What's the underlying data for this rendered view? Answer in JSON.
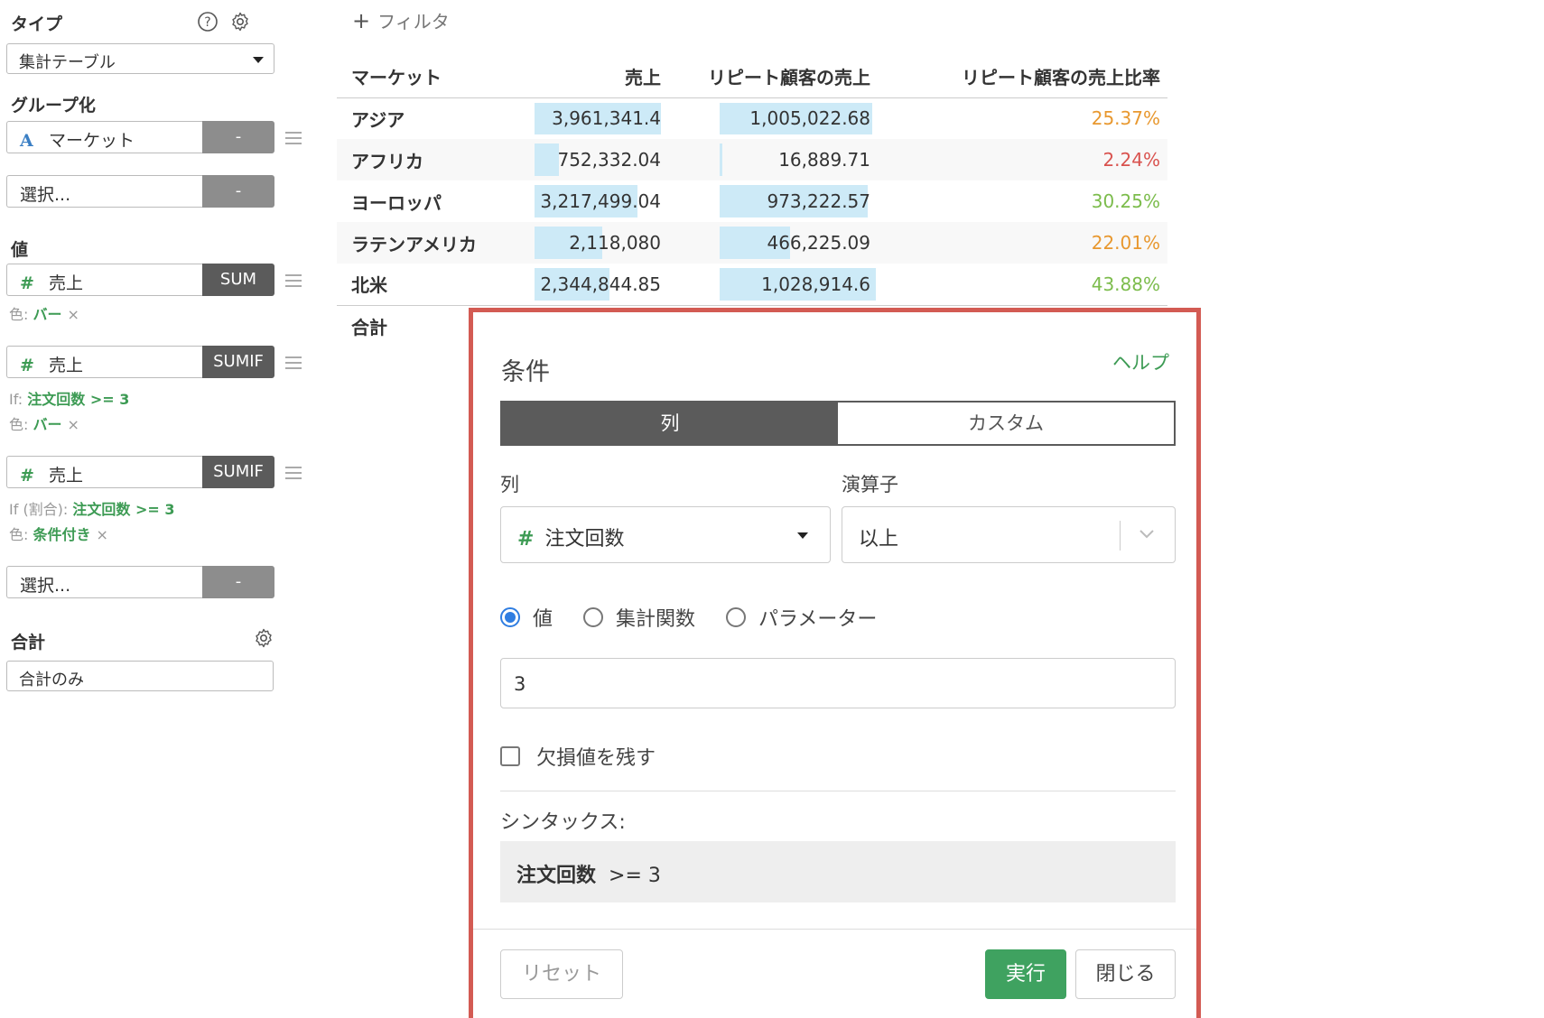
{
  "left_panel": {
    "type": {
      "title": "タイプ",
      "selected": "集計テーブル"
    },
    "group": {
      "title": "グループ化",
      "field": {
        "type_icon": "A",
        "name": "マーケット",
        "agg": "-"
      },
      "empty": {
        "placeholder": "選択...",
        "agg": "-"
      }
    },
    "values": {
      "title": "値",
      "items": [
        {
          "type_icon": "#",
          "name": "売上",
          "agg": "SUM",
          "color_label": "色:",
          "color_value": "バー",
          "remove": "×"
        },
        {
          "type_icon": "#",
          "name": "売上",
          "agg": "SUMIF",
          "if_label": "If:",
          "if_value": "注文回数 >= 3",
          "color_label": "色:",
          "color_value": "バー",
          "remove": "×"
        },
        {
          "type_icon": "#",
          "name": "売上",
          "agg": "SUMIF",
          "if_label": "If (割合):",
          "if_value": "注文回数 >= 3",
          "color_label": "色:",
          "color_value": "条件付き",
          "remove": "×"
        }
      ],
      "empty": {
        "placeholder": "選択...",
        "agg": "-"
      }
    },
    "total": {
      "title": "合計",
      "selected": "合計のみ"
    }
  },
  "filter": {
    "plus": "+",
    "label": "フィルタ"
  },
  "table": {
    "headers": [
      "マーケット",
      "売上",
      "リピート顧客の売上",
      "リピート顧客の売上比率"
    ],
    "rows": [
      {
        "market": "アジア",
        "sales": "3,961,341.4",
        "sales_bar": 1.0,
        "repeat": "1,005,022.68",
        "repeat_bar": 0.977,
        "ratio": "25.37%",
        "ratio_color": "#e8982f"
      },
      {
        "market": "アフリカ",
        "sales": "752,332.04",
        "sales_bar": 0.19,
        "repeat": "16,889.71",
        "repeat_bar": 0.016,
        "ratio": "2.24%",
        "ratio_color": "#d9534f"
      },
      {
        "market": "ヨーロッパ",
        "sales": "3,217,499.04",
        "sales_bar": 0.812,
        "repeat": "973,222.57",
        "repeat_bar": 0.946,
        "ratio": "30.25%",
        "ratio_color": "#7cbc4c"
      },
      {
        "market": "ラテンアメリカ",
        "sales": "2,118,080",
        "sales_bar": 0.535,
        "repeat": "466,225.09",
        "repeat_bar": 0.453,
        "ratio": "22.01%",
        "ratio_color": "#e8982f"
      },
      {
        "market": "北米",
        "sales": "2,344,844.85",
        "sales_bar": 0.592,
        "repeat": "1,028,914.6",
        "repeat_bar": 1.0,
        "ratio": "43.88%",
        "ratio_color": "#7cbc4c"
      }
    ],
    "total_label": "合計"
  },
  "dialog": {
    "title": "条件",
    "help": "ヘルプ",
    "tabs": [
      {
        "label": "列",
        "active": true
      },
      {
        "label": "カスタム",
        "active": false
      }
    ],
    "column_label": "列",
    "column_type_icon": "#",
    "column_value": "注文回数",
    "operator_label": "演算子",
    "operator_value": "以上",
    "radios": [
      {
        "label": "値",
        "checked": true
      },
      {
        "label": "集計関数",
        "checked": false
      },
      {
        "label": "パラメーター",
        "checked": false
      }
    ],
    "value": "3",
    "keep_missing_label": "欠損値を残す",
    "syntax_label": "シンタックス:",
    "syntax_column": "注文回数",
    "syntax_rest": ">=  3",
    "reset_label": "リセット",
    "run_label": "実行",
    "close_label": "閉じる"
  },
  "colors": {
    "accent_green": "#3fa260",
    "highlight_border": "#d35b53",
    "bar_fill": "#cdeaf7",
    "radio_blue": "#2f7de1"
  }
}
